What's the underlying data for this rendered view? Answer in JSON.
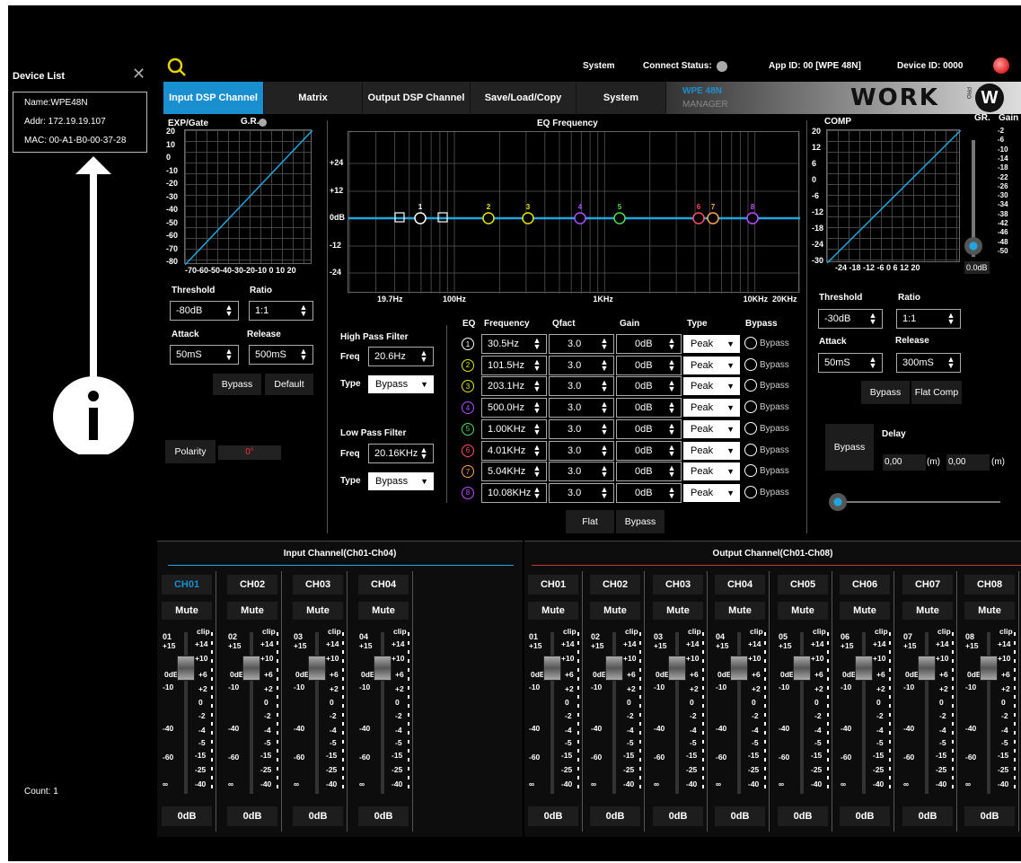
{
  "sidebar": {
    "title": "Device List",
    "device": {
      "name": "Name:WPE48N",
      "addr": "Addr:  172.19.19.107",
      "mac": "MAC:  00-A1-B0-00-37-28"
    },
    "count": "Count:  1"
  },
  "topbar": {
    "system": "System",
    "connect_status": "Connect  Status:",
    "app_id": "App ID:   00  [WPE 48N]",
    "device_id": "Device ID: 0000"
  },
  "tabs": [
    "Input DSP Channel",
    "Matrix",
    "Output DSP Channel",
    "Save/Load/Copy",
    "System"
  ],
  "brand": {
    "line1": "WPE 48N",
    "line2": "MANAGER",
    "logo": "WORK",
    "logo_suffix": "PRO"
  },
  "gate": {
    "title": "EXP/Gate",
    "gr": "G.R.",
    "y_ticks": [
      "20",
      "10",
      "0",
      "-10",
      "-20",
      "-30",
      "-40",
      "-50",
      "-60",
      "-70",
      "-80"
    ],
    "x_ticks": "-70-60-50-40-30-20-10  0 10 20",
    "threshold_label": "Threshold",
    "threshold": "-80dB",
    "ratio_label": "Ratio",
    "ratio": "1:1",
    "attack_label": "Attack",
    "attack": "50mS",
    "release_label": "Release",
    "release": "500mS",
    "bypass": "Bypass",
    "default": "Default"
  },
  "polarity": {
    "label": "Polarity",
    "value": "0°"
  },
  "eq": {
    "title": "EQ Frequency",
    "y_ticks": [
      "+24",
      "+12",
      "0dB",
      "-12",
      "-24"
    ],
    "x_ticks": [
      "19.7Hz",
      "100Hz",
      "1KHz",
      "10KHz",
      "20KHz"
    ],
    "markers": [
      "1",
      "2",
      "3",
      "4",
      "5",
      "6",
      "7",
      "8"
    ],
    "hpf": {
      "title": "High Pass Filter",
      "freq_label": "Freq",
      "freq": "20.6Hz",
      "type_label": "Type",
      "type": "Bypass"
    },
    "lpf": {
      "title": "Low Pass Filter",
      "freq_label": "Freq",
      "freq": "20.16KHz",
      "type_label": "Type",
      "type": "Bypass"
    },
    "headers": {
      "eq": "EQ",
      "frequency": "Frequency",
      "qfact": "Qfact",
      "gain": "Gain",
      "type": "Type",
      "bypass": "Bypass"
    },
    "bands": [
      {
        "n": "1",
        "freq": "30.5Hz",
        "q": "3.0",
        "gain": "0dB",
        "type": "Peak",
        "bypass": "Bypass",
        "color": "#ffffff"
      },
      {
        "n": "2",
        "freq": "101.5Hz",
        "q": "3.0",
        "gain": "0dB",
        "type": "Peak",
        "bypass": "Bypass",
        "color": "#e6e600"
      },
      {
        "n": "3",
        "freq": "203.1Hz",
        "q": "3.0",
        "gain": "0dB",
        "type": "Peak",
        "bypass": "Bypass",
        "color": "#e6e600"
      },
      {
        "n": "4",
        "freq": "500.0Hz",
        "q": "3.0",
        "gain": "0dB",
        "type": "Peak",
        "bypass": "Bypass",
        "color": "#b04dff"
      },
      {
        "n": "5",
        "freq": "1.00KHz",
        "q": "3.0",
        "gain": "0dB",
        "type": "Peak",
        "bypass": "Bypass",
        "color": "#4ddd4d"
      },
      {
        "n": "6",
        "freq": "4.01KHz",
        "q": "3.0",
        "gain": "0dB",
        "type": "Peak",
        "bypass": "Bypass",
        "color": "#ff4d6a"
      },
      {
        "n": "7",
        "freq": "5.04KHz",
        "q": "3.0",
        "gain": "0dB",
        "type": "Peak",
        "bypass": "Bypass",
        "color": "#ffa64d"
      },
      {
        "n": "8",
        "freq": "10.08KHz",
        "q": "3.0",
        "gain": "0dB",
        "type": "Peak",
        "bypass": "Bypass",
        "color": "#c04dff"
      }
    ],
    "flat": "Flat",
    "bypass_btn": "Bypass"
  },
  "comp": {
    "title": "COMP",
    "gr": "GR.",
    "gain": "Gain",
    "y_ticks": [
      "20",
      "12",
      "6",
      "0",
      "-6",
      "-12",
      "-18",
      "-24",
      "-30"
    ],
    "x_ticks": "-24  -18  -12  -6   0    6   12  20",
    "gain_ticks": [
      "-2",
      "-6",
      "-10",
      "-14",
      "-18",
      "-22",
      "-26",
      "-30",
      "-34",
      "-38",
      "-42",
      "-46",
      "-48",
      "-50"
    ],
    "gain_value": "0.0dB",
    "threshold_label": "Threshold",
    "threshold": "-30dB",
    "ratio_label": "Ratio",
    "ratio": "1:1",
    "attack_label": "Attack",
    "attack": "50mS",
    "release_label": "Release",
    "release": "300mS",
    "bypass": "Bypass",
    "flat_comp": "Flat Comp",
    "bypass2": "Bypass",
    "delay_label": "Delay",
    "delay_a": "0,00",
    "delay_unit_a": "(m)",
    "delay_b": "0,00",
    "delay_unit_b": "(m)"
  },
  "input_section": {
    "title": "Input Channel(Ch01-Ch04)",
    "channels": [
      {
        "name": "CH01",
        "num": "01",
        "gain": "0dB",
        "active": true
      },
      {
        "name": "CH02",
        "num": "02",
        "gain": "0dB",
        "active": false
      },
      {
        "name": "CH03",
        "num": "03",
        "gain": "0dB",
        "active": false
      },
      {
        "name": "CH04",
        "num": "04",
        "gain": "0dB",
        "active": false
      }
    ]
  },
  "output_section": {
    "title": "Output Channel(Ch01-Ch08)",
    "channels": [
      {
        "name": "CH01",
        "num": "01",
        "gain": "0dB"
      },
      {
        "name": "CH02",
        "num": "02",
        "gain": "0dB"
      },
      {
        "name": "CH03",
        "num": "03",
        "gain": "0dB"
      },
      {
        "name": "CH04",
        "num": "04",
        "gain": "0dB"
      },
      {
        "name": "CH05",
        "num": "05",
        "gain": "0dB"
      },
      {
        "name": "CH06",
        "num": "06",
        "gain": "0dB"
      },
      {
        "name": "CH07",
        "num": "07",
        "gain": "0dB"
      },
      {
        "name": "CH08",
        "num": "08",
        "gain": "0dB"
      }
    ]
  },
  "fader_scale": {
    "mute": "Mute",
    "clip": "clip",
    "left": [
      "+15",
      "0dB",
      "-10",
      "-40",
      "-60",
      "∞"
    ],
    "right": [
      "+14",
      "+10",
      "+6",
      "+2",
      "0",
      "-2",
      "-4",
      "-5",
      "-15",
      "-25",
      "-40"
    ]
  },
  "colors": {
    "accent": "#1a8fd0",
    "polarity": "#ff2d2d",
    "curve": "#1fa7dd"
  }
}
